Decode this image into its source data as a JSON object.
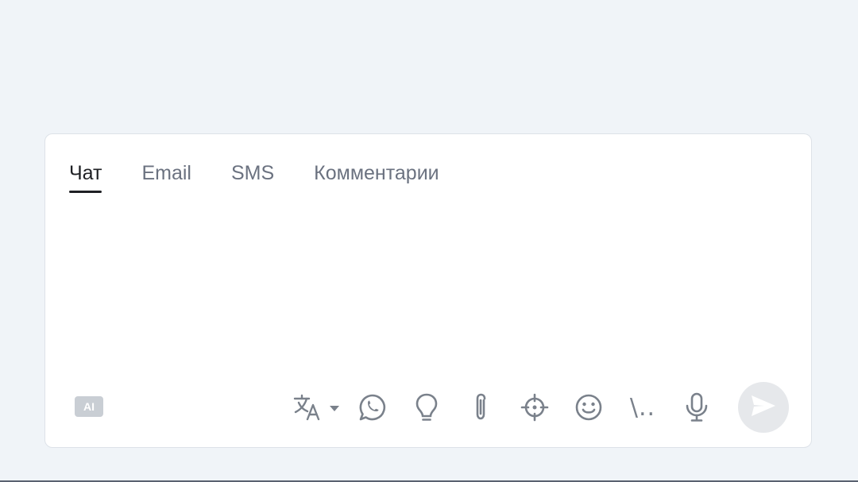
{
  "tabs": [
    {
      "label": "Чат",
      "active": true
    },
    {
      "label": "Email",
      "active": false
    },
    {
      "label": "SMS",
      "active": false
    },
    {
      "label": "Комментарии",
      "active": false
    }
  ],
  "composer": {
    "message_value": "",
    "ai_label": "AI",
    "commands_label": "\\..",
    "tools": [
      "translate-icon",
      "whatsapp-icon",
      "lightbulb-icon",
      "paperclip-icon",
      "crosshair-icon",
      "smiley-icon",
      "commands-icon",
      "microphone-icon"
    ],
    "send_icon": "send-icon"
  },
  "colors": {
    "page_background": "#f0f4f8",
    "icon_gray": "#7a818b",
    "send_button_background": "#e6e8eb",
    "active_tab": "#1f2024"
  }
}
